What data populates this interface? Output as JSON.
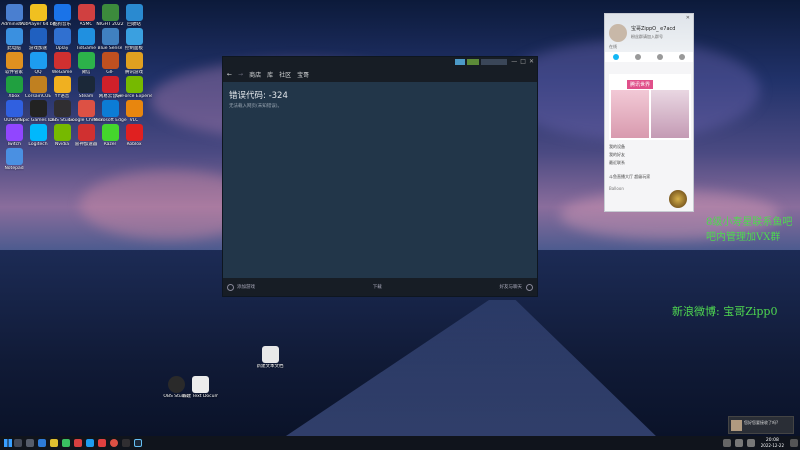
{
  "desktop_icons": [
    {
      "label": "Administr...",
      "color": "#4a7fd0"
    },
    {
      "label": "PotPlayer 64 bit",
      "color": "#f0c020"
    },
    {
      "label": "酷狗音乐",
      "color": "#1a73e8"
    },
    {
      "label": "A5MC",
      "color": "#d04040"
    },
    {
      "label": "NIGHT 2022",
      "color": "#3c8a3c"
    },
    {
      "label": "回收站",
      "color": "#2a8ad0"
    },
    {
      "label": "此电脑",
      "color": "#3a90e0"
    },
    {
      "label": "游戏加速",
      "color": "#2060c0"
    },
    {
      "label": "Uplay",
      "color": "#3070d0"
    },
    {
      "label": "TidGame",
      "color": "#2090e0"
    },
    {
      "label": "Blue Sense",
      "color": "#4080c0"
    },
    {
      "label": "控制面板",
      "color": "#3aa0e0"
    },
    {
      "label": "软件管家",
      "color": "#e09020"
    },
    {
      "label": "QQ",
      "color": "#1d9cf0"
    },
    {
      "label": "WeGame",
      "color": "#d03030"
    },
    {
      "label": "微信",
      "color": "#2cb24a"
    },
    {
      "label": "GIF",
      "color": "#c05020"
    },
    {
      "label": "腾讯游戏",
      "color": "#e0a020"
    },
    {
      "label": "Xbox",
      "color": "#20a040"
    },
    {
      "label": "CorsairiCUE",
      "color": "#c08020"
    },
    {
      "label": "YY语音",
      "color": "#f0b020"
    },
    {
      "label": "Steam",
      "color": "#1b2838"
    },
    {
      "label": "网易云音乐",
      "color": "#d0202a"
    },
    {
      "label": "GeForce Experience",
      "color": "#76b900"
    },
    {
      "label": "UUGame",
      "color": "#3060e0"
    },
    {
      "label": "Epic Games Launcher",
      "color": "#222222"
    },
    {
      "label": "OBS Studio",
      "color": "#302e31"
    },
    {
      "label": "Google Chrome",
      "color": "#dd5144"
    },
    {
      "label": "Microsoft Edge",
      "color": "#0c7cd5"
    },
    {
      "label": "VLC",
      "color": "#e8860e"
    },
    {
      "label": "Twitch",
      "color": "#9146ff"
    },
    {
      "label": "Logitech",
      "color": "#00b8fc"
    },
    {
      "label": "Nvidia",
      "color": "#76b900"
    },
    {
      "label": "雷神加速器",
      "color": "#d03030"
    },
    {
      "label": "Razer",
      "color": "#44d62c"
    },
    {
      "label": "Roblox",
      "color": "#e02020"
    },
    {
      "label": "Notepad",
      "color": "#4a90e2"
    }
  ],
  "desktop_file": {
    "label": "新建文本文档",
    "color": "#e8e8e8"
  },
  "obs_icon": {
    "label": "OBS Studio",
    "color": "#2a2a2a"
  },
  "doc_icon": {
    "label": "新建 Text Document",
    "color": "#ececec"
  },
  "steam_window": {
    "nav_items": [
      "商店",
      "库",
      "社区",
      "宝哥"
    ],
    "error_title": "错误代码: -324",
    "error_sub": "无法载入网页(未知错误)。",
    "footer_left": "添加游戏",
    "footer_mid": "下载",
    "footer_right": "好友与聊天",
    "accent": "#1b2838",
    "body_color": "#223649"
  },
  "qq_panel": {
    "username": "宝哥ZippO_ e7acd",
    "status": "在线",
    "signature": "粉丝群请加入群号",
    "banner_title": "腾讯世界",
    "list_items": [
      "我的设备",
      "我的好友",
      "最近联系"
    ],
    "feed_text": "斗鱼直播大厅 超级玩家",
    "feed_sub": "Balloon",
    "accent": "#12b7f5"
  },
  "overlay": {
    "line1": "8级小寿星联系鱼吧",
    "line2": "吧内管理加VX群",
    "line3": "新浪微博: 宝哥Zipp0",
    "color": "#4fd850"
  },
  "taskbar": {
    "time": "20:08",
    "date": "2022-12-22",
    "notification": "您好您要接收了吗?"
  }
}
